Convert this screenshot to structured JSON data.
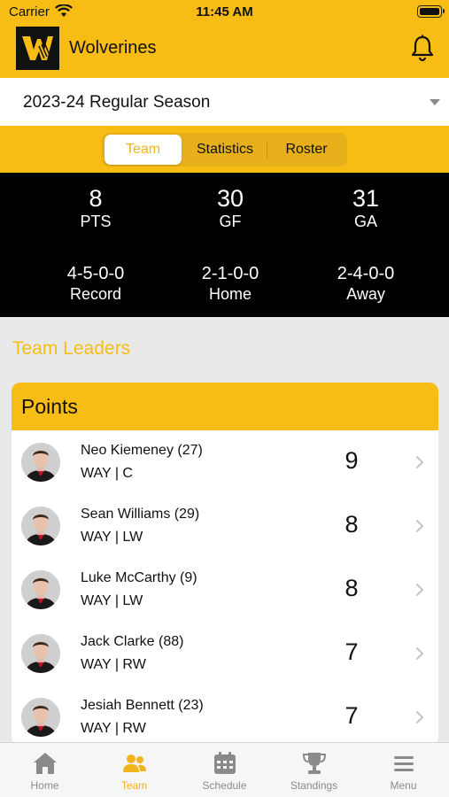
{
  "status_bar": {
    "carrier": "Carrier",
    "time": "11:45 AM"
  },
  "header": {
    "team_name": "Wolverines",
    "logo_icon": "wolverines-logo",
    "bell_icon": "bell-icon"
  },
  "season_selector": {
    "selected": "2023-24 Regular Season"
  },
  "segments": [
    {
      "label": "Team",
      "active": true
    },
    {
      "label": "Statistics",
      "active": false
    },
    {
      "label": "Roster",
      "active": false
    }
  ],
  "team_stats": {
    "pts": {
      "value": "8",
      "label": "PTS"
    },
    "gf": {
      "value": "30",
      "label": "GF"
    },
    "ga": {
      "value": "31",
      "label": "GA"
    },
    "record": {
      "value": "4-5-0-0",
      "label": "Record"
    },
    "home": {
      "value": "2-1-0-0",
      "label": "Home"
    },
    "away": {
      "value": "2-4-0-0",
      "label": "Away"
    }
  },
  "leaders": {
    "section_title": "Team Leaders",
    "card_title": "Points",
    "players": [
      {
        "name": "Neo Kiemeney (27)",
        "team_pos": "WAY | C",
        "value": "9"
      },
      {
        "name": "Sean Williams (29)",
        "team_pos": "WAY | LW",
        "value": "8"
      },
      {
        "name": "Luke McCarthy (9)",
        "team_pos": "WAY | LW",
        "value": "8"
      },
      {
        "name": "Jack Clarke (88)",
        "team_pos": "WAY | RW",
        "value": "7"
      },
      {
        "name": "Jesiah Bennett (23)",
        "team_pos": "WAY | RW",
        "value": "7"
      }
    ]
  },
  "tab_bar": [
    {
      "label": "Home",
      "icon": "home-icon",
      "active": false
    },
    {
      "label": "Team",
      "icon": "team-icon",
      "active": true
    },
    {
      "label": "Schedule",
      "icon": "calendar-icon",
      "active": false
    },
    {
      "label": "Standings",
      "icon": "trophy-icon",
      "active": false
    },
    {
      "label": "Menu",
      "icon": "menu-icon",
      "active": false
    }
  ],
  "colors": {
    "accent": "#f7bd14",
    "stats_bg": "#000000",
    "inactive_tab": "#8a8a8a"
  }
}
